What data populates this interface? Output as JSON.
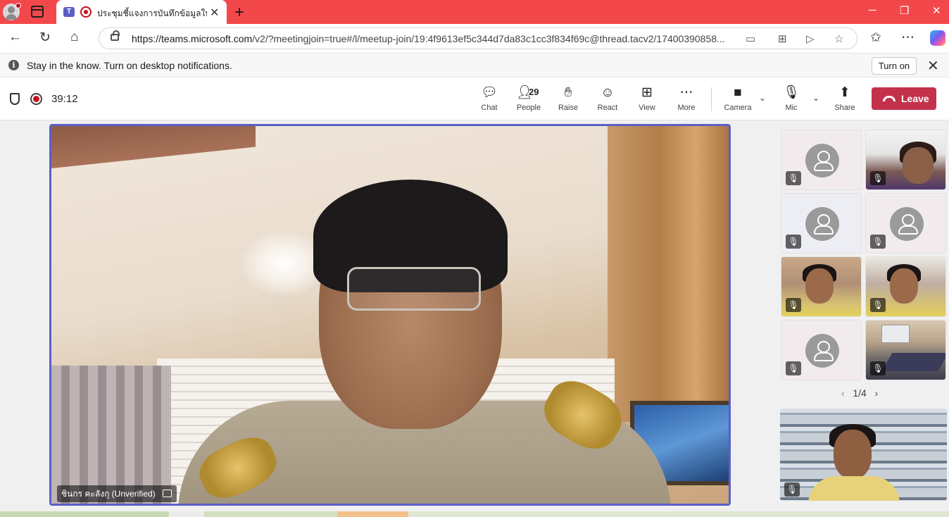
{
  "browser": {
    "tab_title": "ประชุมชี้แจงการบันทึกข้อมูลในระบ",
    "url_host": "https://teams.microsoft.com",
    "url_path": "/v2/?meetingjoin=true#/l/meetup-join/19:4f9613ef5c344d7da83c1cc3f834f69c@thread.tacv2/17400390858..."
  },
  "notification": {
    "text": "Stay in the know. Turn on desktop notifications.",
    "button_label": "Turn on"
  },
  "meeting": {
    "timer": "39:12",
    "controls": {
      "chat": "Chat",
      "people": "People",
      "people_count": "29",
      "raise": "Raise",
      "react": "React",
      "view": "View",
      "more": "More",
      "camera": "Camera",
      "mic": "Mic",
      "share": "Share",
      "leave": "Leave"
    },
    "main_speaker_name": "ชินกร คะลังกุ (Unverified)",
    "pager": "1/4"
  },
  "colors": {
    "browser_accent": "#f3484b",
    "teams_purple": "#5b5fc7",
    "leave_red": "#c4314b"
  }
}
